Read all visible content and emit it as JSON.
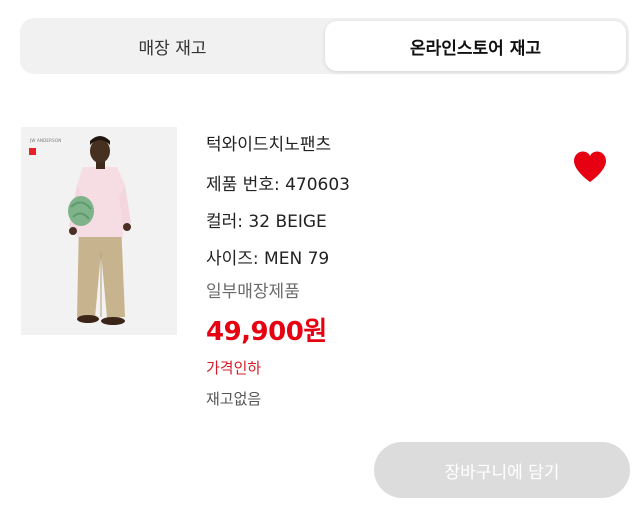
{
  "tabs": {
    "store_label": "매장 재고",
    "online_label": "온라인스토어 재고",
    "selected": "online"
  },
  "product": {
    "brand_mark": "JW ANDERSON",
    "name": "턱와이드치노팬츠",
    "product_no": "제품 번호: 470603",
    "color": "컬러: 32 BEIGE",
    "size": "사이즈: MEN 79",
    "availability": "일부매장제품",
    "price": "49,900원",
    "price_tag": "가격인하",
    "stock_status": "재고없음",
    "favorite": true
  },
  "actions": {
    "add_to_cart": "장바구니에 담기",
    "add_to_cart_enabled": false
  },
  "colors": {
    "price": "#e60012",
    "heart": "#e60012",
    "sale_text": "#d51c2a",
    "button_disabled": "#dcdcdc"
  },
  "icons": {
    "favorite": "heart-icon"
  }
}
